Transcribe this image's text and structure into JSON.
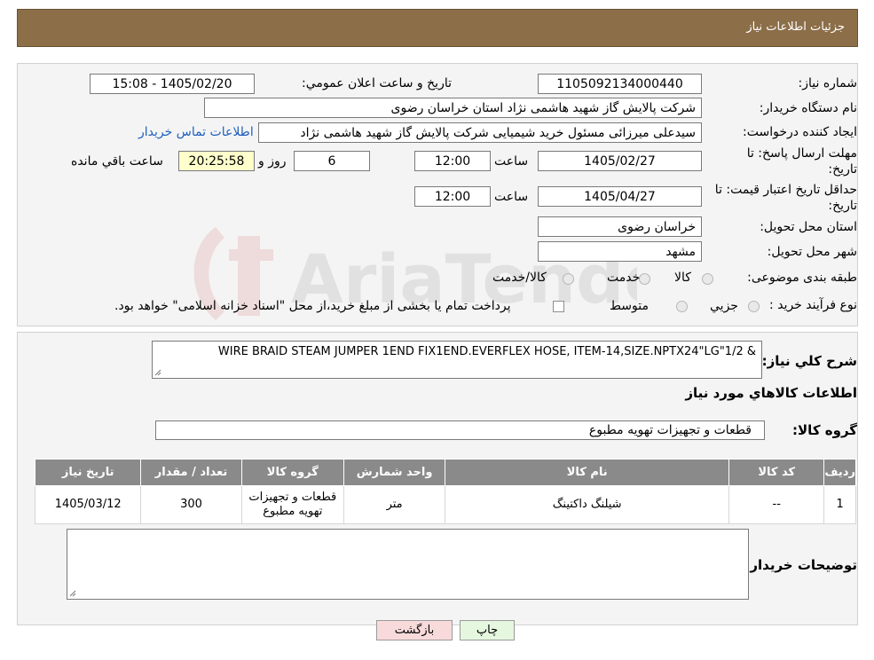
{
  "header": {
    "title": "جزئیات اطلاعات نیاز"
  },
  "fields": {
    "need_number_label": "شماره نیاز:",
    "need_number": "1105092134000440",
    "announce_label": "تاریخ و ساعت اعلان عمومي:",
    "announce_value": "1405/02/20 - 15:08",
    "buyer_label": "نام دستگاه خريدار:",
    "buyer_value": "شرکت پالايش گاز شهيد هاشمی نژاد   استان خراسان رضوی",
    "creator_label": "ايجاد کننده درخواست:",
    "creator_value": "سیدعلی میرزائی مسئول خرید شیمیایی شرکت پالايش گاز شهيد هاشمی نژاد",
    "contact_link": "اطلاعات تماس خريدار",
    "deadline_label_1": "مهلت ارسال پاسخ: تا",
    "deadline_label_2": "تاریخ:",
    "deadline_date": "1405/02/27",
    "time_label": "ساعت",
    "deadline_time": "12:00",
    "days_value": "6",
    "days_label": "روز و",
    "remaining_time": "20:25:58",
    "remaining_label": "ساعت باقي مانده",
    "validity_label_1": "حداقل تاريخ اعتبار قيمت: تا",
    "validity_label_2": "تاريخ:",
    "validity_date": "1405/04/27",
    "validity_time": "12:00",
    "province_label": "استان محل تحويل:",
    "province_value": "خراسان رضوی",
    "city_label": "شهر محل تحويل:",
    "city_value": "مشهد",
    "category_label": "طبقه بندی موضوعی:",
    "category_options": [
      "کالا",
      "خدمت",
      "کالا/خدمت"
    ],
    "process_label": "نوع فرآيند خريد :",
    "process_options": [
      "جزيي",
      "متوسط"
    ],
    "process_note": "پرداخت تمام يا بخشی از مبلغ خريد،از محل \"اسناد خزانه اسلامی\" خواهد بود."
  },
  "description": {
    "label": "شرح کلي نياز:",
    "value": "WIRE BRAID STEAM JUMPER 1END FIX1END.EVERFLEX HOSE, ITEM-14,SIZE.NPTX24\"LG\"1/2 &"
  },
  "goods_info_title": "اطلاعات کالاهاي مورد نياز",
  "goods_group": {
    "label": "گروه کالا:",
    "value": "قطعات و تجهيزات تهويه مطبوع"
  },
  "table": {
    "headers": [
      "رديف",
      "کد کالا",
      "نام کالا",
      "واحد شمارش",
      "گروه کالا",
      "تعداد / مقدار",
      "تاريخ نياز"
    ],
    "rows": [
      [
        "1",
        "--",
        "شيلنگ داکتينگ",
        "متر",
        "قطعات و تجهيزات تهويه مطبوع",
        "300",
        "1405/03/12"
      ]
    ]
  },
  "buyer_notes": {
    "label": "توضيحات خريدار:",
    "value": ""
  },
  "buttons": {
    "print": "چاپ",
    "back": "بازگشت"
  },
  "watermark": {
    "text": "AriaTender.neT"
  },
  "colors": {
    "header": "#8c6e48",
    "table_header": "#8a8a8a",
    "print_btn": "#e6f7e0",
    "back_btn": "#f9dada",
    "link": "#1f5fbf"
  }
}
